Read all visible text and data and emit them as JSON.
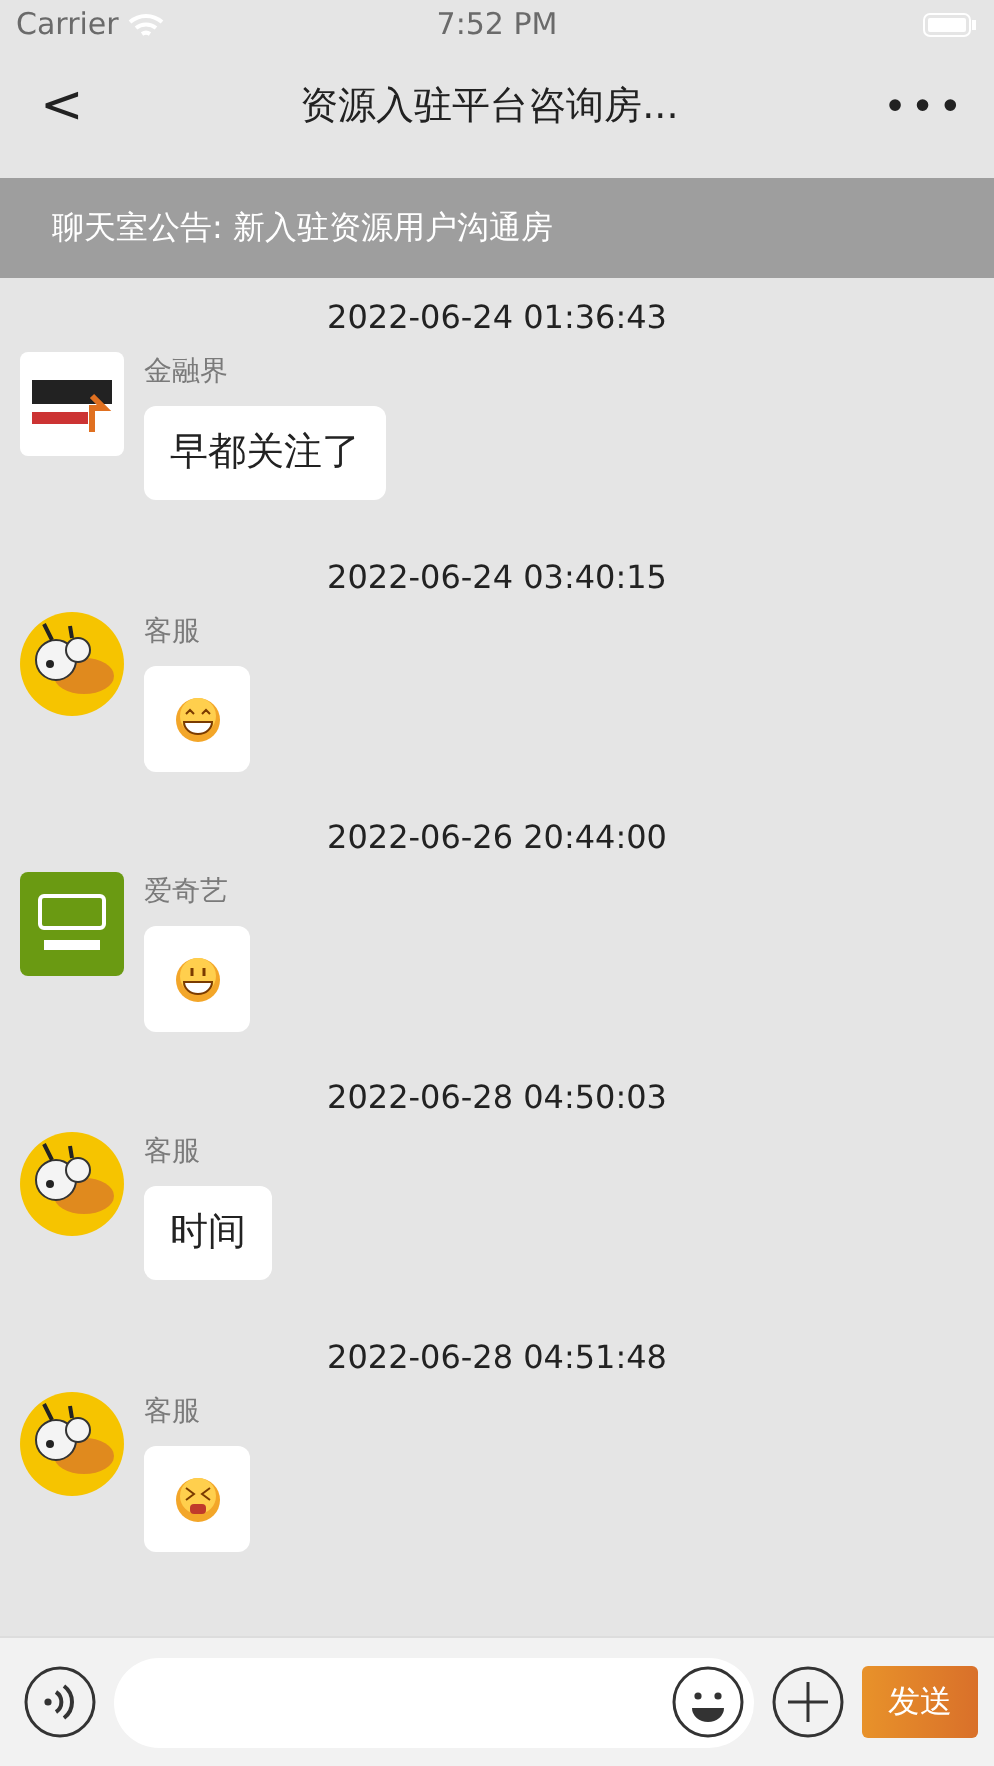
{
  "status_bar": {
    "carrier": "Carrier",
    "time": "7:52 PM"
  },
  "nav": {
    "back": "<",
    "title": "资源入驻平台咨询房...",
    "more": "•••"
  },
  "announcement": "聊天室公告: 新入驻资源用户沟通房",
  "messages": [
    {
      "timestamp": "2022-06-24 01:36:43",
      "sender": "金融界",
      "avatar": {
        "kind": "square"
      },
      "kind": "text",
      "text": "早都关注了"
    },
    {
      "timestamp": "2022-06-24 03:40:15",
      "sender": "客服",
      "avatar": {
        "kind": "mascot"
      },
      "kind": "sticker",
      "sticker": {
        "kind": "grin"
      }
    },
    {
      "timestamp": "2022-06-26 20:44:00",
      "sender": "爱奇艺",
      "avatar": {
        "kind": "green"
      },
      "kind": "sticker",
      "sticker": {
        "kind": "smile"
      }
    },
    {
      "timestamp": "2022-06-28 04:50:03",
      "sender": "客服",
      "avatar": {
        "kind": "mascot"
      },
      "kind": "text",
      "text": "时间"
    },
    {
      "timestamp": "2022-06-28 04:51:48",
      "sender": "客服",
      "avatar": {
        "kind": "mascot"
      },
      "kind": "sticker",
      "sticker": {
        "kind": "upset"
      }
    }
  ],
  "input_bar": {
    "send": "发送"
  }
}
